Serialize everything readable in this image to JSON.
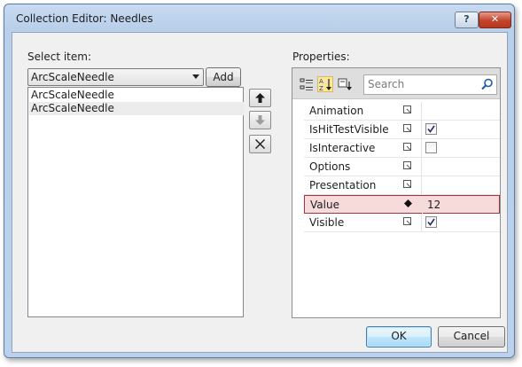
{
  "window": {
    "title": "Collection Editor: Needles",
    "help_label": "?",
    "close_label": "✕"
  },
  "left": {
    "select_label": "Select item:",
    "combo_value": "ArcScaleNeedle",
    "add_label": "Add",
    "items": [
      {
        "label": "ArcScaleNeedle"
      },
      {
        "label": "ArcScaleNeedle"
      }
    ]
  },
  "right": {
    "properties_label": "Properties:",
    "search_placeholder": "Search",
    "rows": [
      {
        "name": "Animation",
        "value": "",
        "type": "text"
      },
      {
        "name": "IsHitTestVisible",
        "value": "true",
        "type": "checkbox"
      },
      {
        "name": "IsInteractive",
        "value": "false",
        "type": "checkbox"
      },
      {
        "name": "Options",
        "value": "",
        "type": "text"
      },
      {
        "name": "Presentation",
        "value": "",
        "type": "text"
      },
      {
        "name": "Value",
        "value": "12",
        "type": "text"
      },
      {
        "name": "Visible",
        "value": "true",
        "type": "checkbox"
      }
    ]
  },
  "footer": {
    "ok_label": "OK",
    "cancel_label": "Cancel"
  },
  "icons": {
    "categorized": "categorized-icon",
    "alphabetical": "sort-alphabetical-icon",
    "filter": "filter-icon",
    "search": "search-icon",
    "move_up": "arrow-up-icon",
    "move_down": "arrow-down-icon",
    "remove": "delete-x-icon"
  },
  "colors": {
    "selected_row_border": "#a8323b",
    "selected_row_bg": "#f7dada",
    "ok_accent": "#3c7fb1"
  }
}
